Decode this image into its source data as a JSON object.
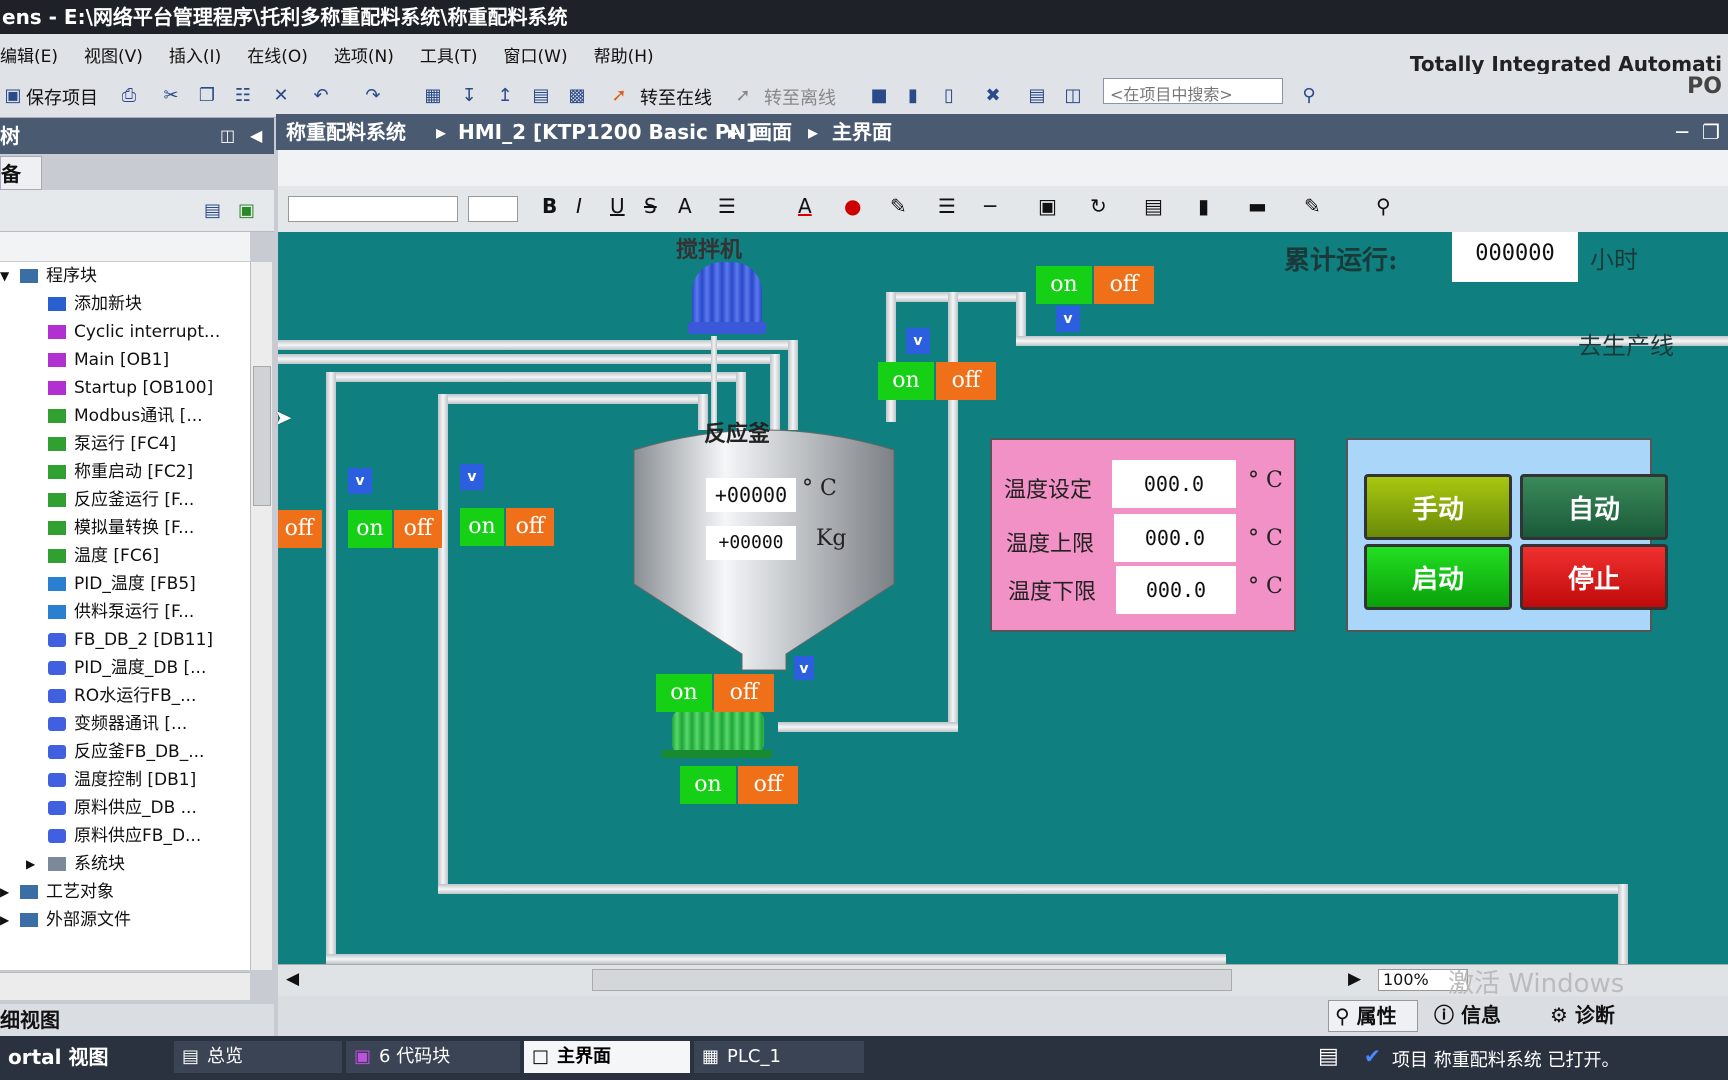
{
  "window": {
    "title": "ens  -  E:\\网络平台管理程序\\托利多称重配料系统\\称重配料系统"
  },
  "menu": [
    "编辑(E)",
    "视图(V)",
    "插入(I)",
    "在线(O)",
    "选项(N)",
    "工具(T)",
    "窗口(W)",
    "帮助(H)"
  ],
  "brand": {
    "line1": "Totally Integrated Automati",
    "line2": "PO"
  },
  "toolbar": {
    "save_label": "保存项目",
    "go_online": "转至在线",
    "go_offline": "转至离线",
    "search_placeholder": "<在项目中搜索>"
  },
  "left": {
    "header": "树",
    "tab": "备",
    "detail": "细视图",
    "portal": "ortal 视图"
  },
  "tree": {
    "items": [
      {
        "label": "程序块",
        "color": "#3a6ea5"
      },
      {
        "label": "添加新块",
        "color": "#2a5fd0"
      },
      {
        "label": "Cyclic interrupt...",
        "color": "#b030d0"
      },
      {
        "label": "Main [OB1]",
        "color": "#b030d0"
      },
      {
        "label": "Startup [OB100]",
        "color": "#b030d0"
      },
      {
        "label": "Modbus通讯 [...",
        "color": "#30a030"
      },
      {
        "label": "泵运行 [FC4]",
        "color": "#30a030"
      },
      {
        "label": "称重启动 [FC2]",
        "color": "#30a030"
      },
      {
        "label": "反应釜运行 [F...",
        "color": "#30a030"
      },
      {
        "label": "模拟量转换 [F...",
        "color": "#30a030"
      },
      {
        "label": "温度 [FC6]",
        "color": "#30a030"
      },
      {
        "label": "PID_温度 [FB5]",
        "color": "#2a7fd0"
      },
      {
        "label": "供料泵运行 [F...",
        "color": "#2a7fd0"
      },
      {
        "label": "FB_DB_2 [DB11]",
        "color": "#4060e0"
      },
      {
        "label": "PID_温度_DB [...",
        "color": "#4060e0"
      },
      {
        "label": "RO水运行FB_...",
        "color": "#4060e0"
      },
      {
        "label": "变频器通讯 [...",
        "color": "#4060e0"
      },
      {
        "label": "反应釜FB_DB_...",
        "color": "#4060e0"
      },
      {
        "label": "温度控制 [DB1]",
        "color": "#4060e0"
      },
      {
        "label": "原料供应_DB ...",
        "color": "#4060e0"
      },
      {
        "label": "原料供应FB_D...",
        "color": "#4060e0"
      },
      {
        "label": "系统块",
        "color": "#7a8a9a"
      },
      {
        "label": "工艺对象",
        "color": "#3a6ea5"
      },
      {
        "label": "外部源文件",
        "color": "#3a6ea5"
      }
    ]
  },
  "breadcrumb": {
    "a": "称重配料系统",
    "b": "HMI_2 [KTP1200 Basic PN]",
    "c": "画面",
    "d": "主界面"
  },
  "hmi": {
    "mixer": "搅拌机",
    "reactor": "反应釜",
    "runtime_label": "累计运行:",
    "runtime_value": "000000",
    "runtime_unit": "小时",
    "to_line": "去生产线",
    "reactor_temp": "+00000",
    "reactor_temp_unit": "°  C",
    "reactor_weight": "+00000",
    "reactor_weight_unit": "Kg",
    "temp_set_label": "温度设定",
    "temp_high_label": "温度上限",
    "temp_low_label": "温度下限",
    "temp_set": "000.0",
    "temp_high": "000.0",
    "temp_low": "000.0",
    "deg": "°  C",
    "on": "on",
    "off": "off",
    "valve": "v",
    "manual": "手动",
    "auto": "自动",
    "start": "启动",
    "stop": "停止"
  },
  "zoom": "100%",
  "watermark": "激活 Windows",
  "props": {
    "properties": "属性",
    "info": "信息",
    "diag": "诊断"
  },
  "bottom": {
    "overview": "总览",
    "codeblocks": "6 代码块",
    "main": "主界面",
    "plc": "PLC_1",
    "status": "项目 称重配料系统 已打开。"
  }
}
